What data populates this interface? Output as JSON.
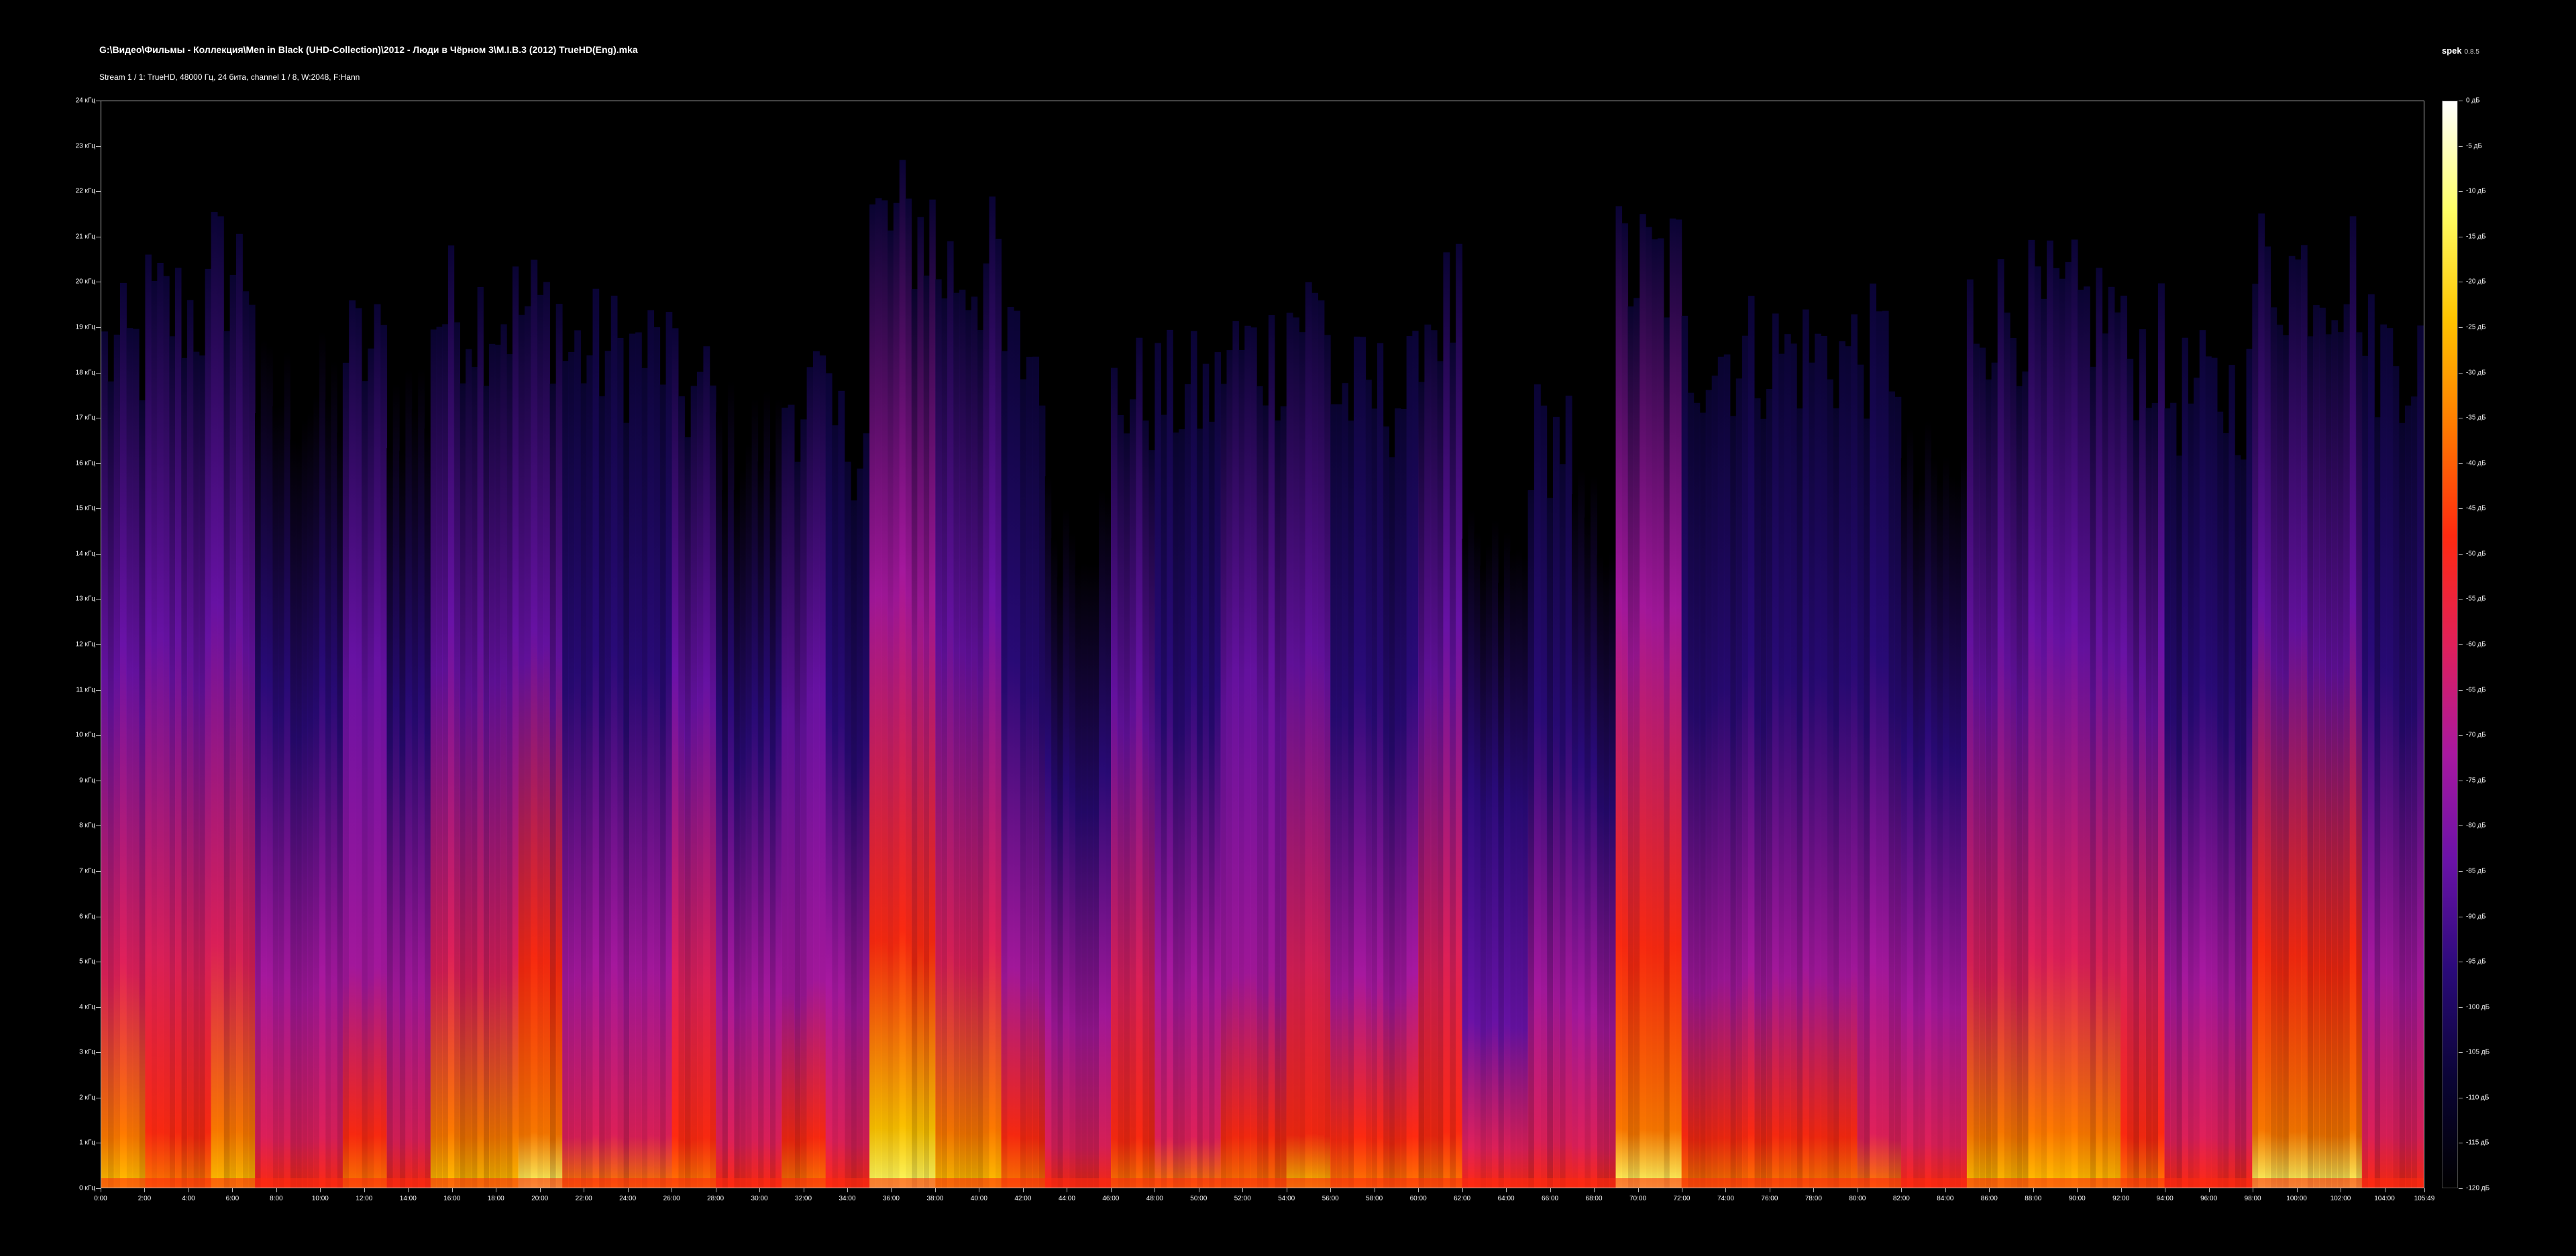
{
  "header": {
    "file_path": "G:\\Видео\\Фильмы - Коллекция\\Men in Black (UHD-Collection)\\2012 - Люди в Чёрном 3\\M.I.B.3 (2012) TrueHD(Eng).mka",
    "stream_info": "Stream 1 / 1: TrueHD, 48000 Гц, 24 бита, channel 1 / 8, W:2048, F:Hann",
    "app_name": "spek",
    "app_version": "0.8.5"
  },
  "colors": {
    "background": "#000000",
    "axis": "#bbbbbb",
    "palette": [
      "#000000",
      "#0a0435",
      "#2a0a7a",
      "#6a12a8",
      "#a818a0",
      "#e0205a",
      "#ff2a10",
      "#ff7a00",
      "#ffc400",
      "#ffff66",
      "#ffffff"
    ]
  },
  "chart_data": {
    "type": "heatmap",
    "x_axis": {
      "unit": "mm:ss",
      "range": [
        "0:00",
        "105:49"
      ],
      "tick_labels": [
        "0:00",
        "2:00",
        "4:00",
        "6:00",
        "8:00",
        "10:00",
        "12:00",
        "14:00",
        "16:00",
        "18:00",
        "20:00",
        "22:00",
        "24:00",
        "26:00",
        "28:00",
        "30:00",
        "32:00",
        "34:00",
        "36:00",
        "38:00",
        "40:00",
        "42:00",
        "44:00",
        "46:00",
        "48:00",
        "50:00",
        "52:00",
        "54:00",
        "56:00",
        "58:00",
        "60:00",
        "62:00",
        "64:00",
        "66:00",
        "68:00",
        "70:00",
        "72:00",
        "74:00",
        "76:00",
        "78:00",
        "80:00",
        "82:00",
        "84:00",
        "86:00",
        "88:00",
        "90:00",
        "92:00",
        "94:00",
        "96:00",
        "98:00",
        "100:00",
        "102:00",
        "104:00",
        "105:49"
      ],
      "tick_minutes": [
        0,
        2,
        4,
        6,
        8,
        10,
        12,
        14,
        16,
        18,
        20,
        22,
        24,
        26,
        28,
        30,
        32,
        34,
        36,
        38,
        40,
        42,
        44,
        46,
        48,
        50,
        52,
        54,
        56,
        58,
        60,
        62,
        64,
        66,
        68,
        70,
        72,
        74,
        76,
        78,
        80,
        82,
        84,
        86,
        88,
        90,
        92,
        94,
        96,
        98,
        100,
        102,
        104,
        105.8167
      ]
    },
    "y_axis": {
      "unit": "kHz",
      "range": [
        0,
        24
      ],
      "tick_labels": [
        "0 кГц",
        "1 кГц",
        "2 кГц",
        "3 кГц",
        "4 кГц",
        "5 кГц",
        "6 кГц",
        "7 кГц",
        "8 кГц",
        "9 кГц",
        "10 кГц",
        "11 кГц",
        "12 кГц",
        "13 кГц",
        "14 кГц",
        "15 кГц",
        "16 кГц",
        "17 кГц",
        "18 кГц",
        "19 кГц",
        "20 кГц",
        "21 кГц",
        "22 кГц",
        "23 кГц",
        "24 кГц"
      ]
    },
    "color_scale": {
      "unit": "dB",
      "range": [
        -120,
        0
      ],
      "tick_labels": [
        "0 дБ",
        "-5 дБ",
        "-10 дБ",
        "-15 дБ",
        "-20 дБ",
        "-25 дБ",
        "-30 дБ",
        "-35 дБ",
        "-40 дБ",
        "-45 дБ",
        "-50 дБ",
        "-55 дБ",
        "-60 дБ",
        "-65 дБ",
        "-70 дБ",
        "-75 дБ",
        "-80 дБ",
        "-85 дБ",
        "-90 дБ",
        "-95 дБ",
        "-100 дБ",
        "-105 дБ",
        "-110 дБ",
        "-115 дБ",
        "-120 дБ"
      ]
    },
    "activity_profile": {
      "description_unit": "peak normalized intensity per minute band",
      "segments": [
        {
          "start_min": 0,
          "end_min": 2,
          "intensity": 0.75,
          "max_khz": 20
        },
        {
          "start_min": 2,
          "end_min": 5,
          "intensity": 0.6,
          "max_khz": 21
        },
        {
          "start_min": 5,
          "end_min": 7,
          "intensity": 0.8,
          "max_khz": 22
        },
        {
          "start_min": 7,
          "end_min": 11,
          "intensity": 0.3,
          "max_khz": 19
        },
        {
          "start_min": 11,
          "end_min": 13,
          "intensity": 0.55,
          "max_khz": 20
        },
        {
          "start_min": 13,
          "end_min": 15,
          "intensity": 0.35,
          "max_khz": 19
        },
        {
          "start_min": 15,
          "end_min": 19,
          "intensity": 0.85,
          "max_khz": 21
        },
        {
          "start_min": 19,
          "end_min": 21,
          "intensity": 0.9,
          "max_khz": 21
        },
        {
          "start_min": 21,
          "end_min": 26,
          "intensity": 0.45,
          "max_khz": 20
        },
        {
          "start_min": 26,
          "end_min": 28,
          "intensity": 0.6,
          "max_khz": 19
        },
        {
          "start_min": 28,
          "end_min": 31,
          "intensity": 0.35,
          "max_khz": 18
        },
        {
          "start_min": 31,
          "end_min": 33,
          "intensity": 0.55,
          "max_khz": 19
        },
        {
          "start_min": 33,
          "end_min": 35,
          "intensity": 0.4,
          "max_khz": 18
        },
        {
          "start_min": 35,
          "end_min": 38,
          "intensity": 1.0,
          "max_khz": 23
        },
        {
          "start_min": 38,
          "end_min": 41,
          "intensity": 0.85,
          "max_khz": 22
        },
        {
          "start_min": 41,
          "end_min": 43,
          "intensity": 0.5,
          "max_khz": 20
        },
        {
          "start_min": 43,
          "end_min": 46,
          "intensity": 0.35,
          "max_khz": 16
        },
        {
          "start_min": 46,
          "end_min": 48,
          "intensity": 0.6,
          "max_khz": 19
        },
        {
          "start_min": 48,
          "end_min": 51,
          "intensity": 0.45,
          "max_khz": 19
        },
        {
          "start_min": 51,
          "end_min": 54,
          "intensity": 0.55,
          "max_khz": 20
        },
        {
          "start_min": 54,
          "end_min": 56,
          "intensity": 0.7,
          "max_khz": 21
        },
        {
          "start_min": 56,
          "end_min": 60,
          "intensity": 0.5,
          "max_khz": 19
        },
        {
          "start_min": 60,
          "end_min": 62,
          "intensity": 0.6,
          "max_khz": 21
        },
        {
          "start_min": 62,
          "end_min": 65,
          "intensity": 0.25,
          "max_khz": 15
        },
        {
          "start_min": 65,
          "end_min": 67,
          "intensity": 0.4,
          "max_khz": 18
        },
        {
          "start_min": 67,
          "end_min": 69,
          "intensity": 0.3,
          "max_khz": 16
        },
        {
          "start_min": 69,
          "end_min": 72,
          "intensity": 0.95,
          "max_khz": 22
        },
        {
          "start_min": 72,
          "end_min": 80,
          "intensity": 0.5,
          "max_khz": 20
        },
        {
          "start_min": 80,
          "end_min": 82,
          "intensity": 0.45,
          "max_khz": 20
        },
        {
          "start_min": 82,
          "end_min": 85,
          "intensity": 0.3,
          "max_khz": 17
        },
        {
          "start_min": 85,
          "end_min": 92,
          "intensity": 0.85,
          "max_khz": 21
        },
        {
          "start_min": 92,
          "end_min": 94,
          "intensity": 0.6,
          "max_khz": 20
        },
        {
          "start_min": 94,
          "end_min": 98,
          "intensity": 0.4,
          "max_khz": 19
        },
        {
          "start_min": 98,
          "end_min": 103,
          "intensity": 0.9,
          "max_khz": 22
        },
        {
          "start_min": 103,
          "end_min": 105.8,
          "intensity": 0.4,
          "max_khz": 20
        }
      ]
    }
  }
}
